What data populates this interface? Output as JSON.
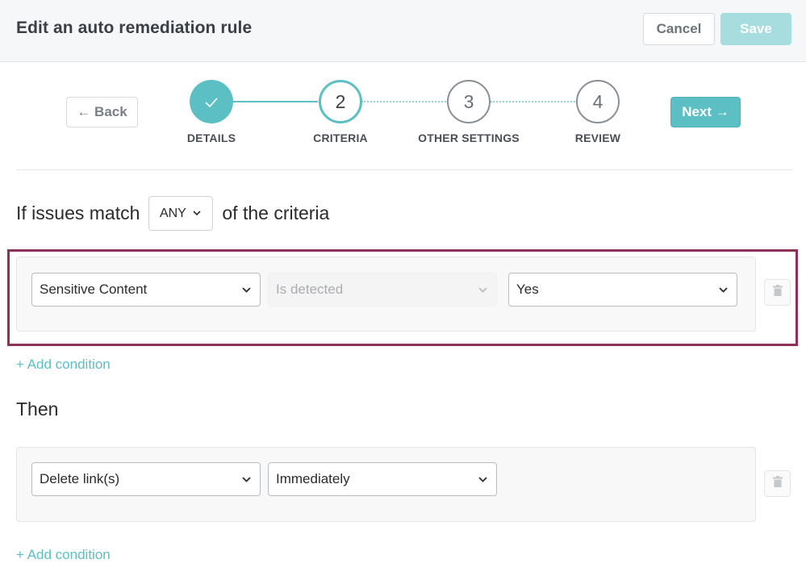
{
  "header": {
    "title": "Edit an auto remediation rule",
    "cancel_label": "Cancel",
    "save_label": "Save"
  },
  "wizard": {
    "back_label": "← Back",
    "next_label": "Next →",
    "steps": [
      {
        "number": "✓",
        "label": "DETAILS",
        "state": "done"
      },
      {
        "number": "2",
        "label": "CRITERIA",
        "state": "active"
      },
      {
        "number": "3",
        "label": "OTHER SETTINGS",
        "state": "todo"
      },
      {
        "number": "4",
        "label": "REVIEW",
        "state": "todo"
      }
    ]
  },
  "criteria": {
    "prefix": "If issues match",
    "match_value": "ANY",
    "suffix": "of the criteria",
    "conditions": [
      {
        "field": "Sensitive Content",
        "operator": "Is detected",
        "value": "Yes"
      }
    ],
    "add_condition_label": "+ Add condition"
  },
  "then": {
    "heading": "Then",
    "actions": [
      {
        "action": "Delete link(s)",
        "timing": "Immediately"
      }
    ],
    "add_condition_label": "+ Add condition"
  },
  "colors": {
    "accent": "#5bbfc4",
    "save_disabled": "#a8dde0",
    "highlight_border": "#8c3158"
  },
  "icons": [
    "check-icon",
    "arrow-left-icon",
    "arrow-right-icon",
    "chevron-down-icon",
    "trash-icon"
  ]
}
